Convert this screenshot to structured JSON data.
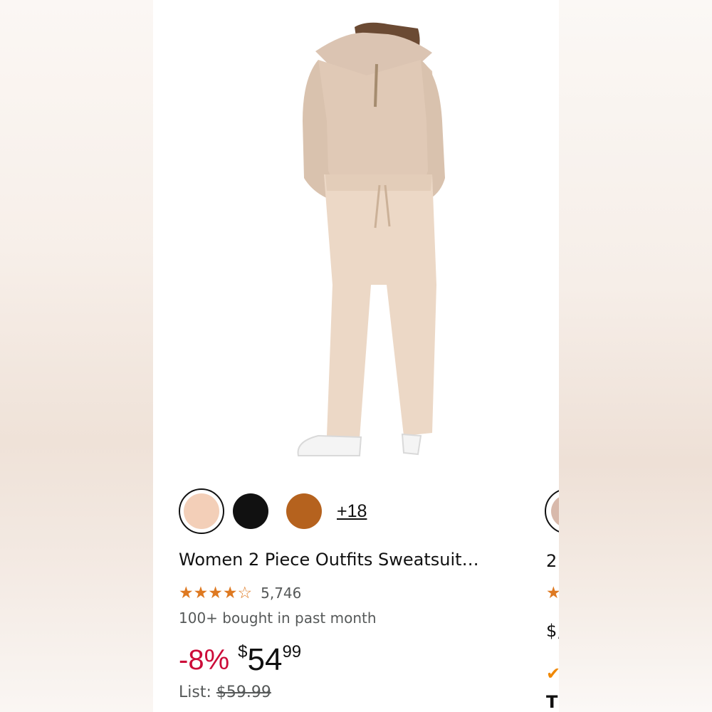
{
  "product": {
    "swatches": [
      {
        "name": "beige",
        "color": "#f3cfb8",
        "selected": true
      },
      {
        "name": "black",
        "color": "#111111",
        "selected": false
      },
      {
        "name": "brown",
        "color": "#b5621e",
        "selected": false
      }
    ],
    "more_colors": "+18",
    "title": "Women 2 Piece Outfits Sweatsuit…",
    "rating": 4.5,
    "review_count": "5,746",
    "bought_text": "100+ bought in past month",
    "discount": "-8%",
    "price_symbol": "$",
    "price_whole": "54",
    "price_fraction": "99",
    "list_label": "List:",
    "list_price": "$59.99",
    "colors": {
      "accent_red": "#cc0c39",
      "star": "#de7921",
      "secondary_text": "#565959"
    }
  },
  "next_card": {
    "title_fragment": "2",
    "price_fragment": "$,",
    "badge_fragment": "T"
  }
}
